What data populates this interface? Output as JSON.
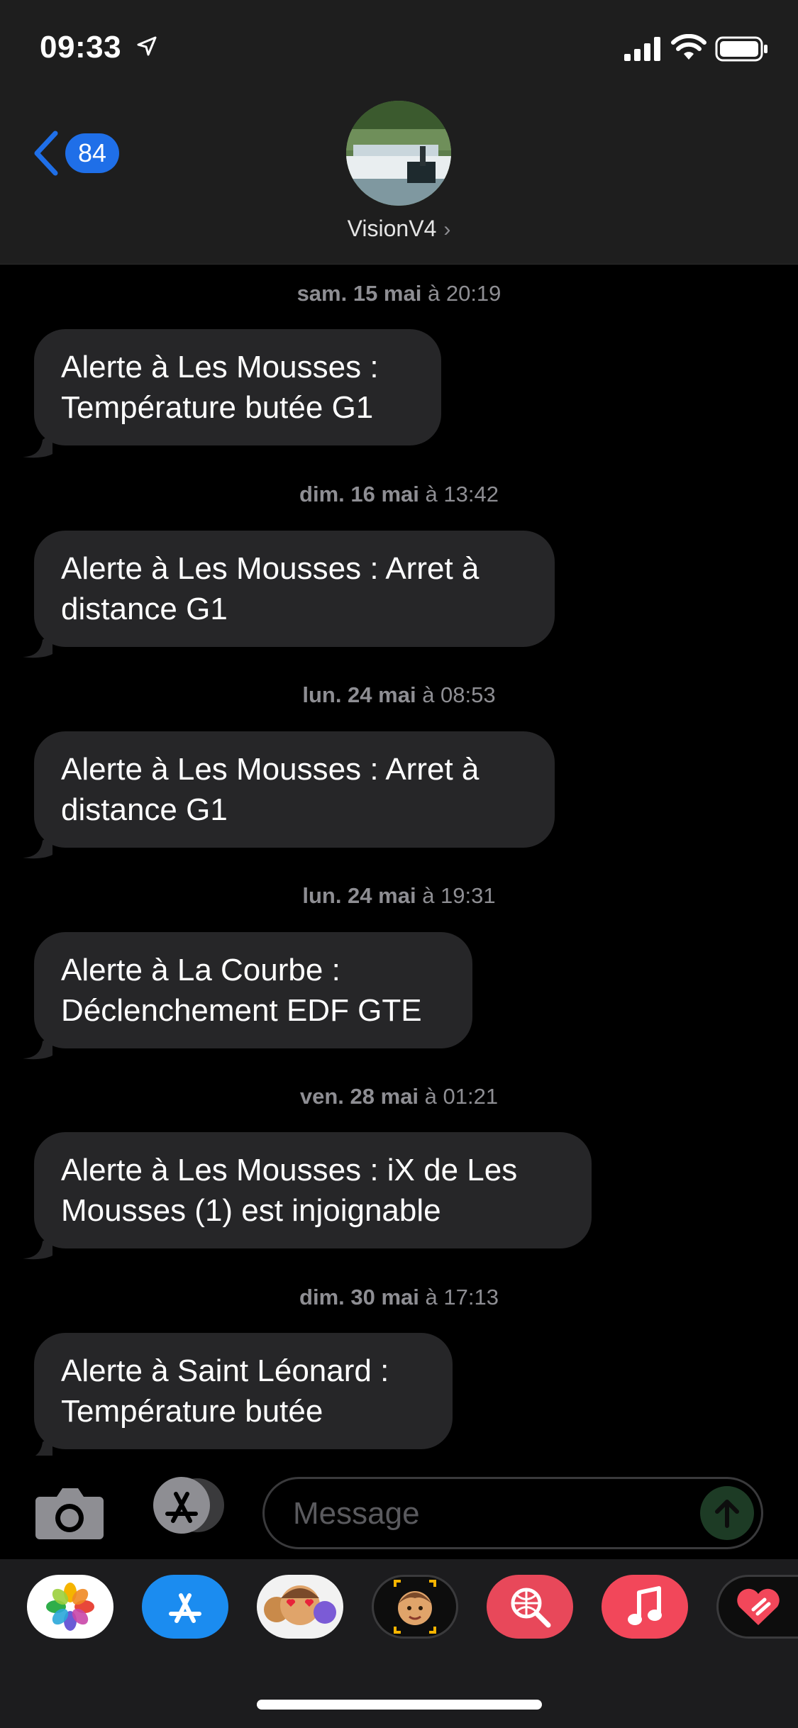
{
  "status_bar": {
    "time": "09:33"
  },
  "header": {
    "back_badge": "84",
    "contact_name": "VisionV4",
    "contact_chevron": "›"
  },
  "messages": [
    {
      "timestamp_day": "sam. 15 mai",
      "timestamp_time": "à 20:19",
      "lines": [
        "Alerte à Les Mousses :",
        "Température butée G1"
      ]
    },
    {
      "timestamp_day": "dim. 16 mai",
      "timestamp_time": "à 13:42",
      "lines": [
        "Alerte à Les Mousses : Arret à",
        "distance G1"
      ]
    },
    {
      "timestamp_day": "lun. 24 mai",
      "timestamp_time": "à 08:53",
      "lines": [
        "Alerte à Les Mousses : Arret à",
        "distance G1"
      ]
    },
    {
      "timestamp_day": "lun. 24 mai",
      "timestamp_time": "à 19:31",
      "lines": [
        "Alerte à La Courbe :",
        "Déclenchement EDF GTE"
      ]
    },
    {
      "timestamp_day": "ven. 28 mai",
      "timestamp_time": "à 01:21",
      "lines": [
        "Alerte à Les Mousses : iX de Les",
        "Mousses (1) est injoignable"
      ]
    },
    {
      "timestamp_day": "dim. 30 mai",
      "timestamp_time": "à 17:13",
      "lines": [
        "Alerte à Saint Léonard :",
        "Température butée"
      ]
    }
  ],
  "input": {
    "placeholder": "Message"
  },
  "drawer_apps": [
    {
      "icon": "photos-icon"
    },
    {
      "icon": "app-store-icon"
    },
    {
      "icon": "animoji-icon"
    },
    {
      "icon": "memoji-icon"
    },
    {
      "icon": "web-search-icon"
    },
    {
      "icon": "music-icon"
    },
    {
      "icon": "digital-touch-icon"
    }
  ],
  "colors": {
    "header_bg": "#1e1e1e",
    "bubble_bg": "#262628",
    "timestamp": "#8e8e93",
    "accent_blue": "#1f6fe8",
    "send_disabled": "#1d3b25"
  }
}
